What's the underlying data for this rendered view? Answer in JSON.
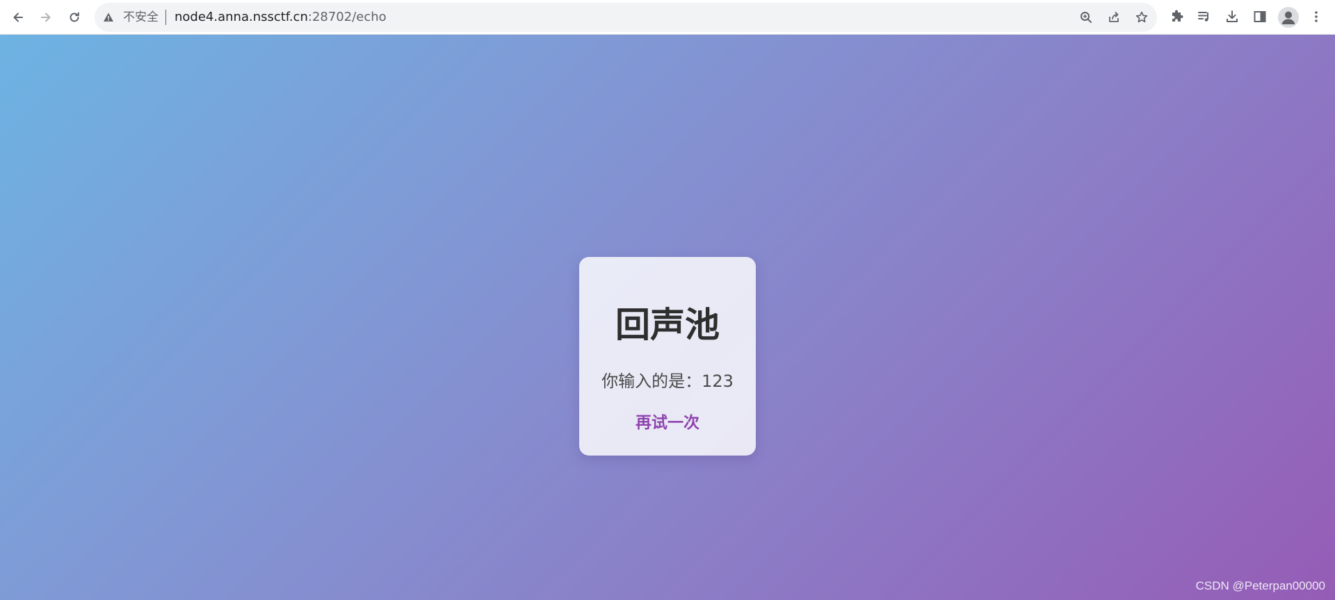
{
  "browser": {
    "insecure_label": "不安全",
    "url_host": "node4.anna.nssctf.cn",
    "url_path": ":28702/echo",
    "icons": {
      "back": "back-arrow-icon",
      "forward": "forward-arrow-icon",
      "reload": "reload-icon",
      "warning": "warning-icon",
      "zoom": "zoom-icon",
      "share": "share-icon",
      "bookmark": "star-icon",
      "extensions": "puzzle-icon",
      "media": "media-playlist-icon",
      "downloads": "download-icon",
      "side_panel": "side-panel-icon",
      "profile": "avatar-icon",
      "menu": "kebab-menu-icon"
    }
  },
  "page": {
    "title": "回声池",
    "message": "你输入的是：123",
    "retry_link": "再试一次",
    "accent_color": "#8e44ad"
  },
  "watermark": "CSDN @Peterpan00000"
}
